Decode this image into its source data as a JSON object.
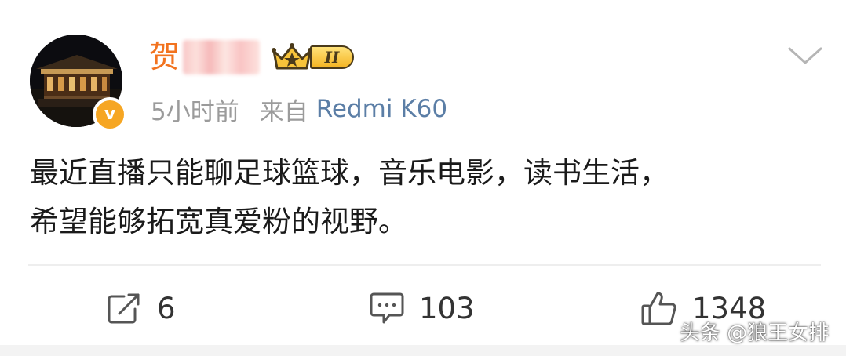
{
  "post": {
    "author_name": "贺",
    "vip_level": "II",
    "time": "5小时前",
    "from_label": "来自",
    "source": "Redmi K60",
    "verified_mark": "v",
    "content_lines": [
      "最近直播只能聊足球篮球，音乐电影，读书生活，",
      "希望能够拓宽真爱粉的视野。"
    ]
  },
  "actions": {
    "repost_count": "6",
    "comment_count": "103",
    "like_count": "1348"
  },
  "watermark": "头条 @狼王女排",
  "colors": {
    "name": "#f2731f",
    "source_link": "#5b7ea6",
    "meta": "#9b9b9b",
    "verified_badge": "#f6a623"
  },
  "icons": {
    "repost": "repost-icon",
    "comment": "comment-icon",
    "like": "thumbs-up-icon",
    "menu": "chevron-down-icon"
  }
}
